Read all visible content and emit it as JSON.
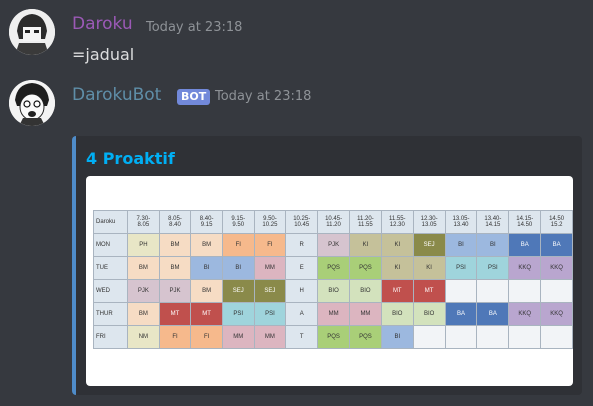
{
  "messages": [
    {
      "username": "Daroku",
      "username_color": "#9b59b6",
      "timestamp": "Today at 23:18",
      "content": "=jadual"
    },
    {
      "username": "DarokuBot",
      "username_color": "#5f8ea8",
      "bot_tag": "BOT",
      "timestamp": "Today at 23:18",
      "embed": {
        "title": "4 Proaktif",
        "accent_color": "#4f8cc9",
        "timetable": {
          "header": [
            "Daroku",
            "7.30-\n8.05",
            "8.05-\n8.40",
            "8.40-\n9.15",
            "9.15-\n9.50",
            "9.50-\n10.25",
            "10.25-\n10.45",
            "10.45-\n11.20",
            "11.20-\n11.55",
            "11.55-\n12.30",
            "12.30-\n13.05",
            "13.05-\n13.40",
            "13.40-\n14.15",
            "14.15-\n14.50",
            "14.50\n15.2"
          ],
          "rows": [
            {
              "day": "MON",
              "cells": [
                "PH",
                "BM",
                "BM",
                "FI",
                "FI",
                "R",
                "PJK",
                "KI",
                "KI",
                "SEJ",
                "BI",
                "BI",
                "BA",
                "BA"
              ]
            },
            {
              "day": "TUE",
              "cells": [
                "BM",
                "BM",
                "BI",
                "BI",
                "MM",
                "E",
                "PQS",
                "PQS",
                "KI",
                "KI",
                "PSI",
                "PSI",
                "KKQ",
                "KKQ"
              ]
            },
            {
              "day": "WED",
              "cells": [
                "PJK",
                "PJK",
                "BM",
                "SEJ",
                "SEJ",
                "H",
                "BIO",
                "BIO",
                "MT",
                "MT",
                "",
                "",
                "",
                ""
              ]
            },
            {
              "day": "THUR",
              "cells": [
                "BM",
                "MT",
                "MT",
                "PSI",
                "PSI",
                "A",
                "MM",
                "MM",
                "BIO",
                "BIO",
                "BA",
                "BA",
                "KKQ",
                "KKQ"
              ]
            },
            {
              "day": "FRI",
              "cells": [
                "NM",
                "FI",
                "FI",
                "MM",
                "MM",
                "T",
                "PQS",
                "PQS",
                "BI",
                "",
                "",
                "",
                "",
                ""
              ]
            }
          ],
          "subject_colors": {
            "PH": "#e8e6c6",
            "BM": "#f6dcc4",
            "FI": "#f6b98c",
            "R": "#dde6ee",
            "E": "#dde6ee",
            "H": "#dde6ee",
            "A": "#dde6ee",
            "T": "#dde6ee",
            "PJK": "#d6c4cf",
            "KI": "#c5c19a",
            "SEJ": "#8a8a4a",
            "BI": "#9cb8df",
            "BA": "#4f78b8",
            "PQS": "#a9cf78",
            "MM": "#dcb5c0",
            "PSI": "#9fd4dc",
            "KKQ": "#b9a6cf",
            "BIO": "#d3e2bd",
            "MT": "#c0504d",
            "NM": "#e8e6c6",
            "": "#f2f4f7"
          }
        }
      }
    }
  ]
}
